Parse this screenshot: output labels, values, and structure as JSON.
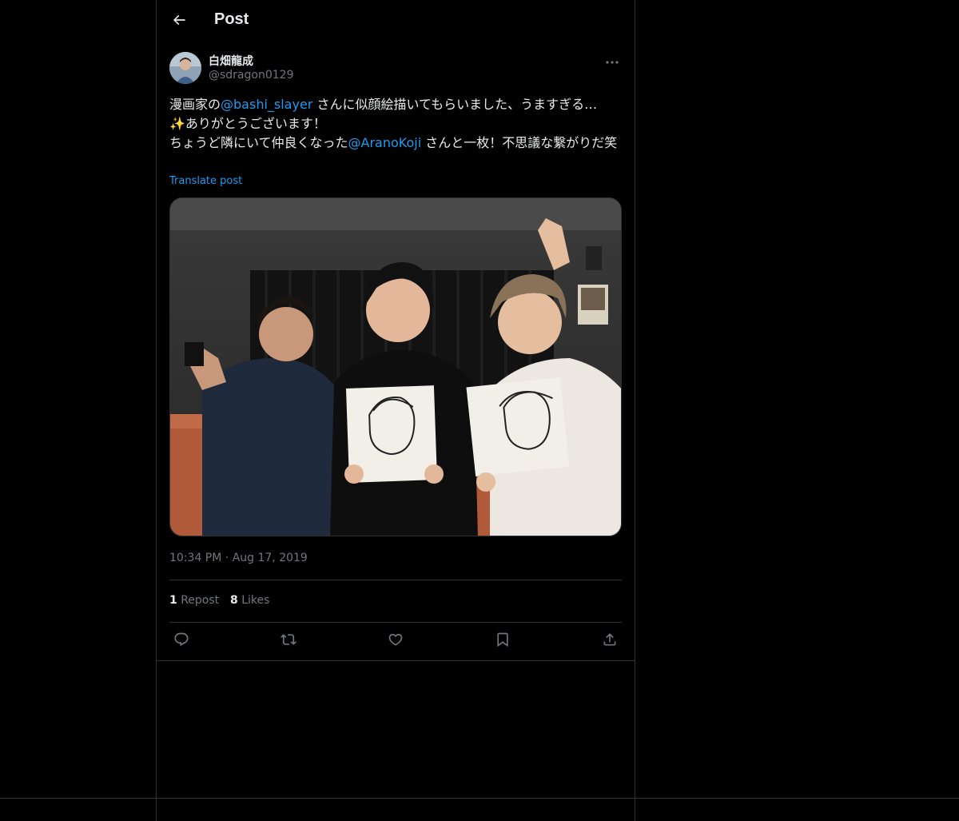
{
  "header": {
    "title": "Post",
    "back_icon": "arrow-left-icon"
  },
  "author": {
    "display_name": "白畑龍成",
    "handle": "@sdragon0129",
    "more_icon": "more-horizontal-icon"
  },
  "tweet": {
    "line1_prefix": "漫画家の",
    "mention1": "@bashi_slayer",
    "line1_suffix": " さんに似顔絵描いてもらいました、うますぎる…",
    "line2": "✨ありがとうございます！",
    "line3_prefix": "ちょうど隣にいて仲良くなった",
    "mention2": "@AranoKoji",
    "line3_suffix": " さんと一枚！不思議な繋がりだ笑",
    "translate_label": "Translate post"
  },
  "media": {
    "image_icon": "photo-image"
  },
  "meta": {
    "time": "10:34 PM",
    "separator": " · ",
    "date": "Aug 17, 2019"
  },
  "stats": {
    "reposts_count": "1",
    "reposts_label": "Repost",
    "likes_count": "8",
    "likes_label": "Likes"
  },
  "actions": {
    "reply_icon": "reply-icon",
    "repost_icon": "repost-icon",
    "like_icon": "heart-icon",
    "bookmark_icon": "bookmark-icon",
    "share_icon": "share-icon"
  },
  "colors": {
    "background": "#000000",
    "text": "#e7e9ea",
    "secondary": "#71767b",
    "accent": "#1d9bf0",
    "border": "#2f3336"
  }
}
